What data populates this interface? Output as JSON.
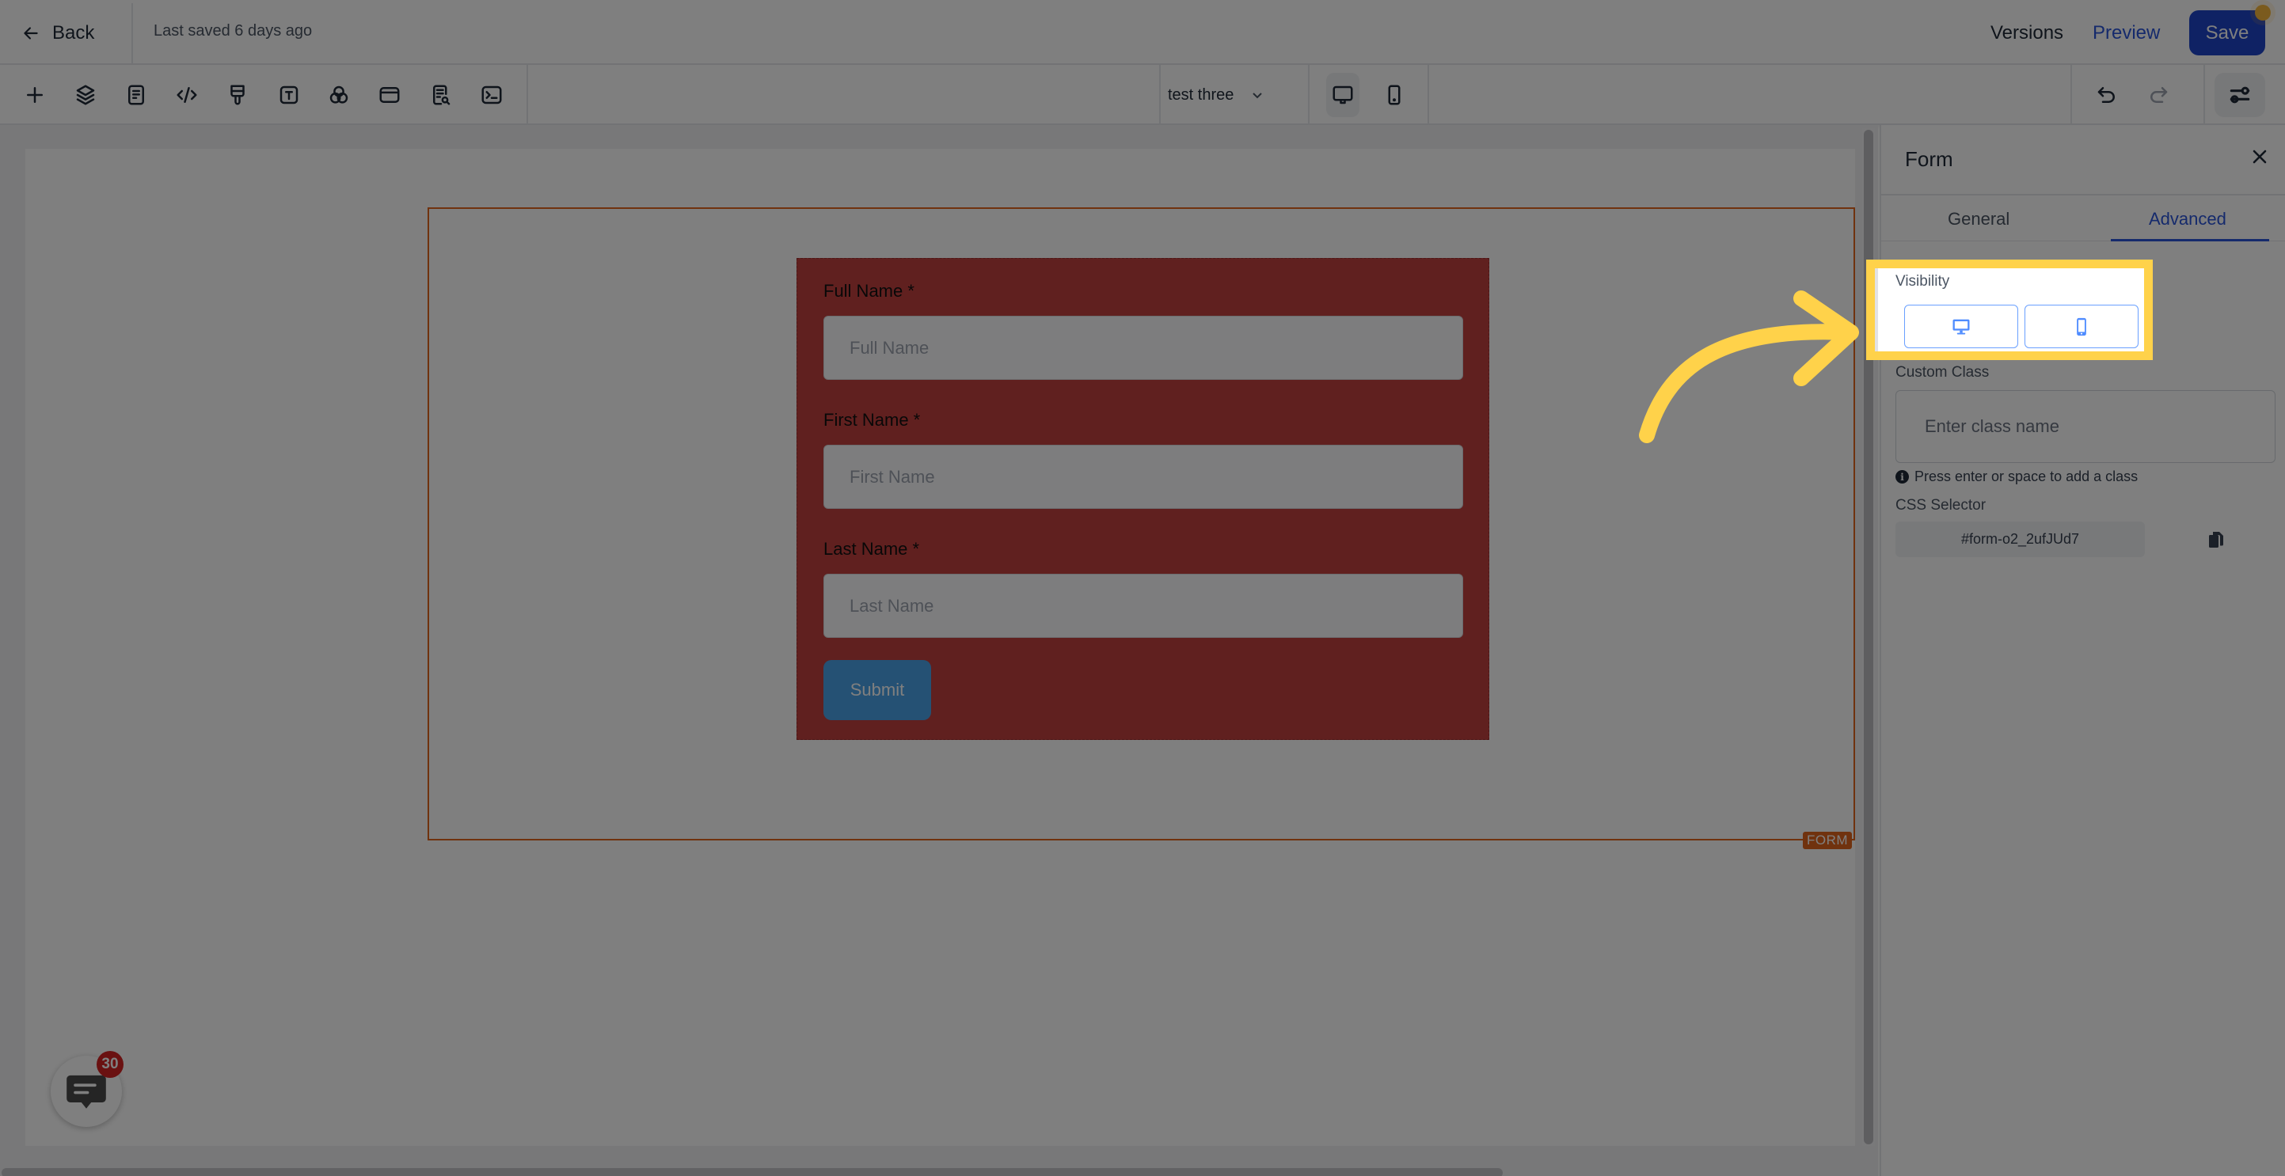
{
  "header": {
    "back_label": "Back",
    "last_saved": "Last saved 6 days ago",
    "versions_label": "Versions",
    "preview_label": "Preview",
    "save_label": "Save"
  },
  "toolbar": {
    "tools": [
      {
        "icon": "plus-icon",
        "label": "Add element"
      },
      {
        "icon": "layers-icon",
        "label": "Layers"
      },
      {
        "icon": "pages-icon",
        "label": "Pages"
      },
      {
        "icon": "code-icon",
        "label": "Custom code"
      },
      {
        "icon": "paint-brush-icon",
        "label": "Styles"
      },
      {
        "icon": "text-icon",
        "label": "Typography"
      },
      {
        "icon": "color-circles-icon",
        "label": "Colors"
      },
      {
        "icon": "window-icon",
        "label": "Popup"
      },
      {
        "icon": "document-search-icon",
        "label": "SEO"
      },
      {
        "icon": "terminal-icon",
        "label": "Tracking code"
      }
    ],
    "page_selector": "test three",
    "device_modes": [
      {
        "icon": "desktop-icon",
        "active": true
      },
      {
        "icon": "mobile-icon",
        "active": false
      }
    ],
    "undo_icon": "undo-icon",
    "redo_icon": "redo-icon",
    "settings_icon": "sliders-icon"
  },
  "canvas": {
    "selected_element_tag": "FORM",
    "form": {
      "fields": [
        {
          "label": "Full Name *",
          "placeholder": "Full Name"
        },
        {
          "label": "First Name *",
          "placeholder": "First Name"
        },
        {
          "label": "Last Name *",
          "placeholder": "Last Name"
        }
      ],
      "submit_label": "Submit",
      "background_color": "#c1413f",
      "button_color": "#4aa3e8"
    },
    "chat_badge_count": "30"
  },
  "panel": {
    "title": "Form",
    "tabs": [
      {
        "label": "General",
        "active": false
      },
      {
        "label": "Advanced",
        "active": true
      }
    ],
    "visibility_label": "Visibility",
    "visibility_options": [
      {
        "icon": "desktop-icon",
        "label": "Desktop"
      },
      {
        "icon": "mobile-icon",
        "label": "Mobile"
      }
    ],
    "custom_class_label": "Custom Class",
    "custom_class_placeholder": "Enter class name",
    "custom_class_hint": "Press enter or space to add a class",
    "css_selector_label": "CSS Selector",
    "css_selector_value": "#form-o2_2ufJUd7"
  },
  "annotation": {
    "highlight_color": "#ffd24a",
    "target": "Visibility"
  }
}
